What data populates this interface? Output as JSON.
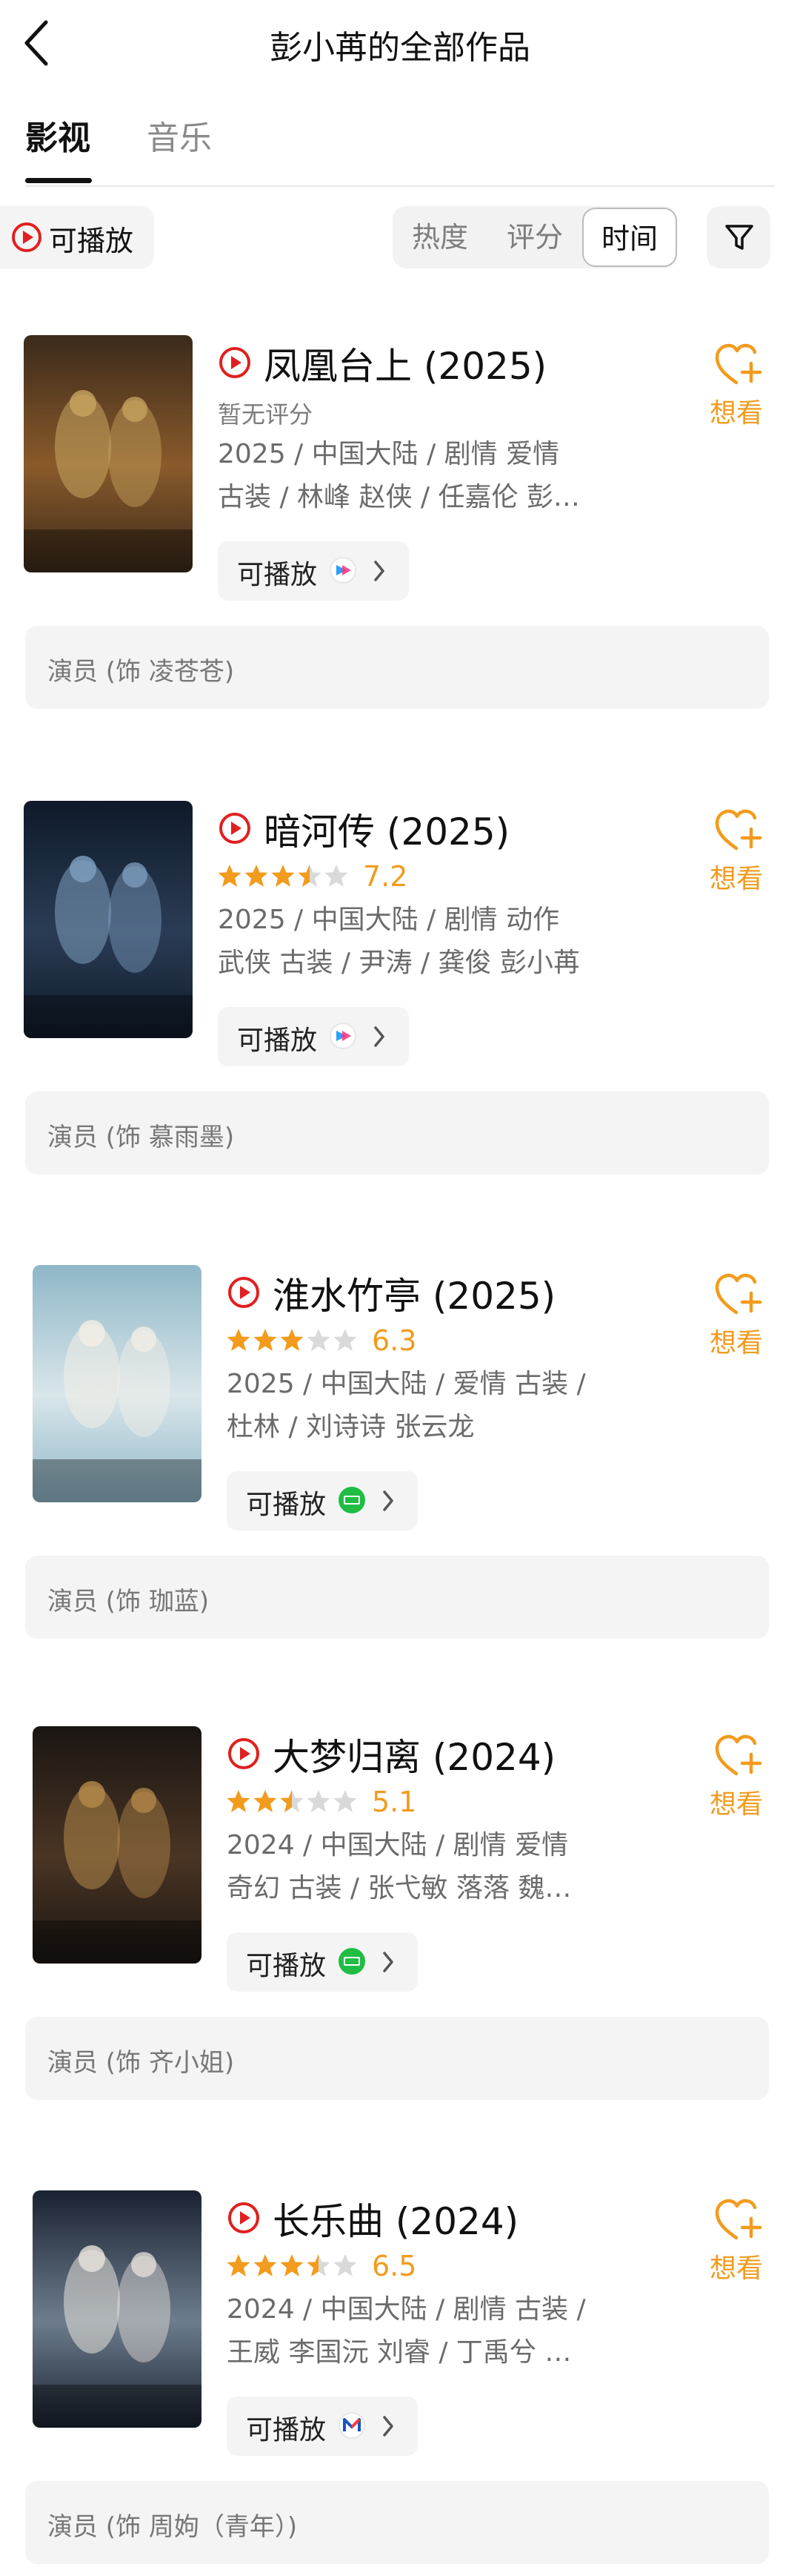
{
  "header": {
    "title": "彭小苒的全部作品"
  },
  "tabs": [
    {
      "label": "影视",
      "active": true
    },
    {
      "label": "音乐",
      "active": false
    }
  ],
  "filters": {
    "playable_label": "可播放",
    "sort_options": [
      {
        "label": "热度",
        "active": false
      },
      {
        "label": "评分",
        "active": false
      },
      {
        "label": "时间",
        "active": true
      }
    ]
  },
  "colors": {
    "accent": "#f29b1d",
    "play_red": "#e02020",
    "chip_bg": "#f4f4f4"
  },
  "works": [
    {
      "title": "凤凰台上 (2025)",
      "rating": null,
      "rating_text": "暂无评分",
      "meta_line1": "2025 / 中国大陆 / 剧情 爱情",
      "meta_line2": "古装 / 林峰 赵侠 / 任嘉伦 彭…",
      "play_label": "可播放",
      "platform_icon": "youku-icon",
      "want_label": "想看",
      "role": "演员 (饰 凌苍苍)",
      "poster_icon": "poster-fenghuang-taishang"
    },
    {
      "title": "暗河传 (2025)",
      "rating": 7.2,
      "rating_text": "7.2",
      "stars": 3.5,
      "meta_line1": "2025 / 中国大陆 / 剧情 动作",
      "meta_line2": "武侠 古装 / 尹涛 / 龚俊 彭小苒",
      "play_label": "可播放",
      "platform_icon": "youku-icon",
      "want_label": "想看",
      "role": "演员 (饰 慕雨墨)",
      "poster_icon": "poster-anhe-zhuan"
    },
    {
      "title": "淮水竹亭 (2025)",
      "rating": 6.3,
      "rating_text": "6.3",
      "stars": 3,
      "meta_line1": "2025 / 中国大陆 / 爱情 古装 /",
      "meta_line2": "杜林 / 刘诗诗 张云龙",
      "play_label": "可播放",
      "platform_icon": "iqiyi-icon",
      "want_label": "想看",
      "role": "演员 (饰 珈蓝)",
      "poster_icon": "poster-huaishui-zhuting"
    },
    {
      "title": "大梦归离 (2024)",
      "rating": 5.1,
      "rating_text": "5.1",
      "stars": 2.5,
      "meta_line1": "2024 / 中国大陆 / 剧情 爱情",
      "meta_line2": "奇幻 古装 / 张弋敏 落落 魏…",
      "play_label": "可播放",
      "platform_icon": "iqiyi-icon",
      "want_label": "想看",
      "role": "演员 (饰 齐小姐)",
      "poster_icon": "poster-dameng-guili"
    },
    {
      "title": "长乐曲 (2024)",
      "rating": 6.5,
      "rating_text": "6.5",
      "stars": 3.5,
      "meta_line1": "2024 / 中国大陆 / 剧情 古装 /",
      "meta_line2": "王威 李国沅 刘睿 / 丁禹兮 …",
      "play_label": "可播放",
      "platform_icon": "mgtv-icon",
      "want_label": "想看",
      "role": "演员 (饰 周姁（青年）)",
      "poster_icon": "poster-changle-qu"
    }
  ]
}
